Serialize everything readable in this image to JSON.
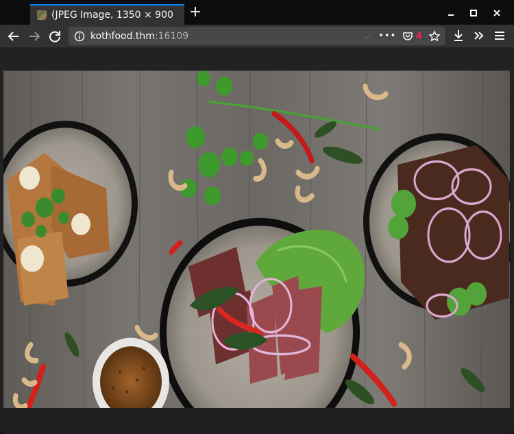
{
  "window": {
    "tab_title": "(JPEG Image, 1350 × 900",
    "new_tab_symbol": "+"
  },
  "navbar": {
    "url_host": "kothfood.thm",
    "url_port": ":16109",
    "page_actions_symbol": "•••",
    "tracking_badge_count": "4"
  },
  "image": {
    "description_icon": "image-icon",
    "natural_width": 1350,
    "natural_height": 900
  },
  "colors": {
    "accent": "#0a84ff",
    "toolbar": "#323234",
    "urlbar": "#474749",
    "badge": "#e22850"
  }
}
